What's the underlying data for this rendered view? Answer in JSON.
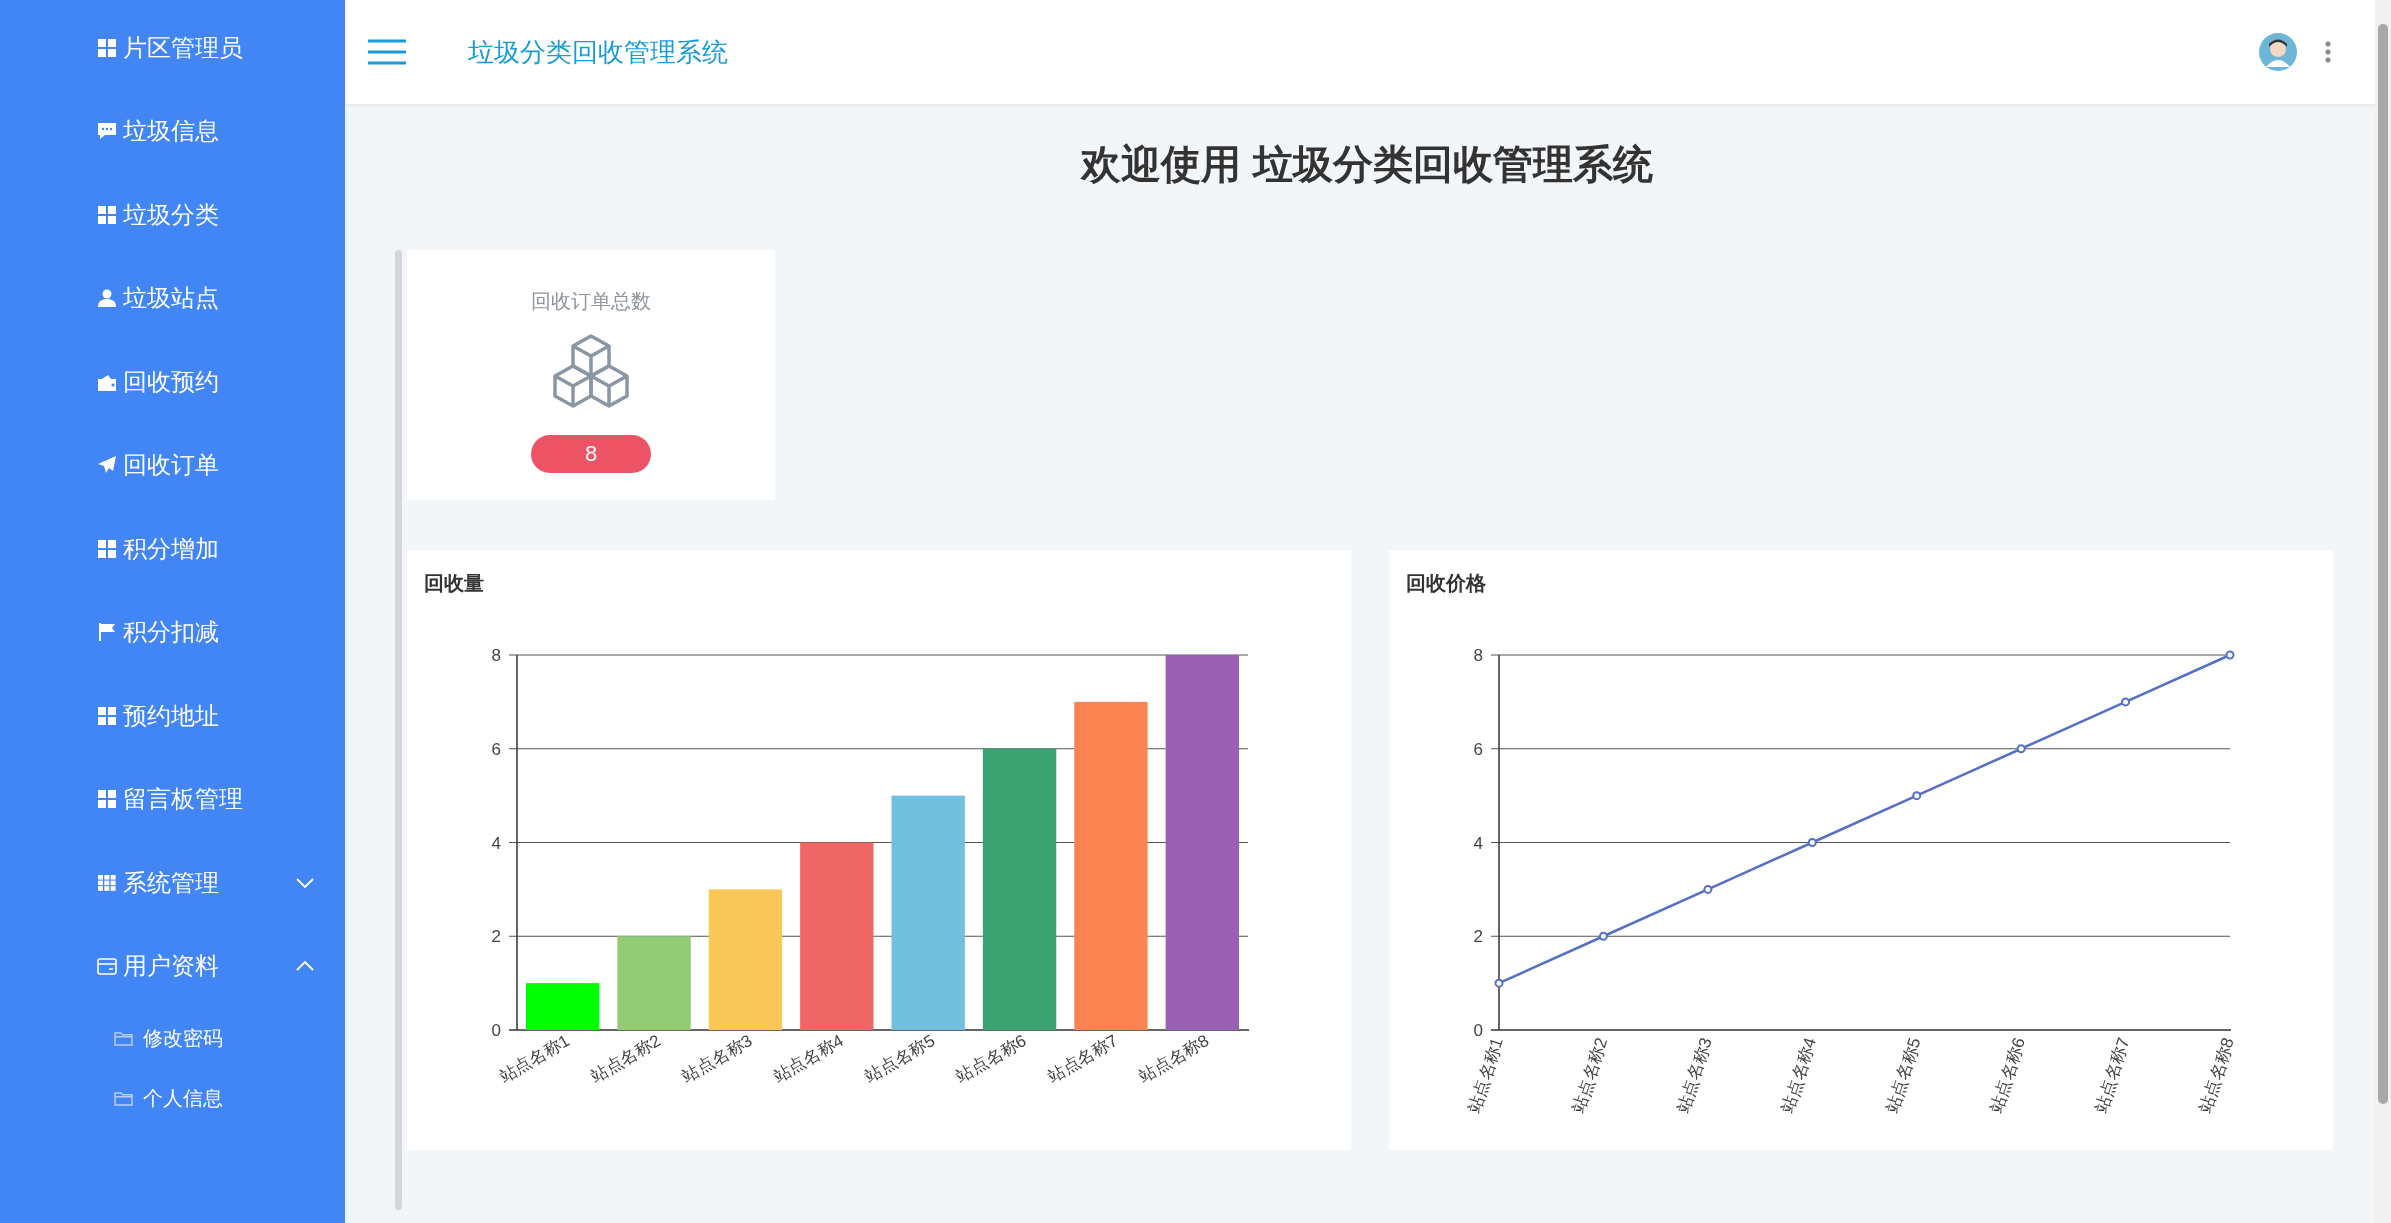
{
  "sidebar": {
    "items": [
      {
        "label": "片区管理员",
        "kind": "grid"
      },
      {
        "label": "垃圾信息",
        "kind": "chat"
      },
      {
        "label": "垃圾分类",
        "kind": "grid"
      },
      {
        "label": "垃圾站点",
        "kind": "person"
      },
      {
        "label": "回收预约",
        "kind": "wallet"
      },
      {
        "label": "回收订单",
        "kind": "send"
      },
      {
        "label": "积分增加",
        "kind": "grid"
      },
      {
        "label": "积分扣减",
        "kind": "flag"
      },
      {
        "label": "预约地址",
        "kind": "grid"
      },
      {
        "label": "留言板管理",
        "kind": "grid"
      },
      {
        "label": "系统管理",
        "kind": "grid9",
        "expanded": false
      },
      {
        "label": "用户资料",
        "kind": "card",
        "expanded": true,
        "children": [
          {
            "label": "修改密码",
            "kind": "folder"
          },
          {
            "label": "个人信息",
            "kind": "folder"
          }
        ]
      }
    ]
  },
  "header": {
    "title": "垃圾分类回收管理系统"
  },
  "page_title": "欢迎使用 垃圾分类回收管理系统",
  "stat_card": {
    "title": "回收订单总数",
    "value": "8"
  },
  "charts": [
    {
      "title": "回收量",
      "chart_data": {
        "type": "bar",
        "categories": [
          "站点名称1",
          "站点名称2",
          "站点名称3",
          "站点名称4",
          "站点名称5",
          "站点名称6",
          "站点名称7",
          "站点名称8"
        ],
        "values": [
          1,
          2,
          3,
          4,
          5,
          6,
          7,
          8
        ],
        "grid": true,
        "colors": [
          "#00ff00",
          "#91cc75",
          "#fac858",
          "#ee6666",
          "#73c0de",
          "#3ba272",
          "#fc8452",
          "#9a60b4"
        ],
        "ylim": [
          0,
          8
        ],
        "yticks": [
          0,
          2,
          4,
          6,
          8
        ]
      }
    },
    {
      "title": "回收价格",
      "chart_data": {
        "type": "line",
        "categories": [
          "站点名称1",
          "站点名称2",
          "站点名称3",
          "站点名称4",
          "站点名称5",
          "站点名称6",
          "站点名称7",
          "站点名称8"
        ],
        "grid": true,
        "series": [
          {
            "color": "#5470c6",
            "marker": true,
            "values": [
              1,
              2,
              3,
              4,
              5,
              6,
              7,
              8
            ]
          }
        ],
        "ylim": [
          0,
          8
        ],
        "yticks": [
          0,
          2,
          4,
          6,
          8
        ]
      }
    }
  ]
}
